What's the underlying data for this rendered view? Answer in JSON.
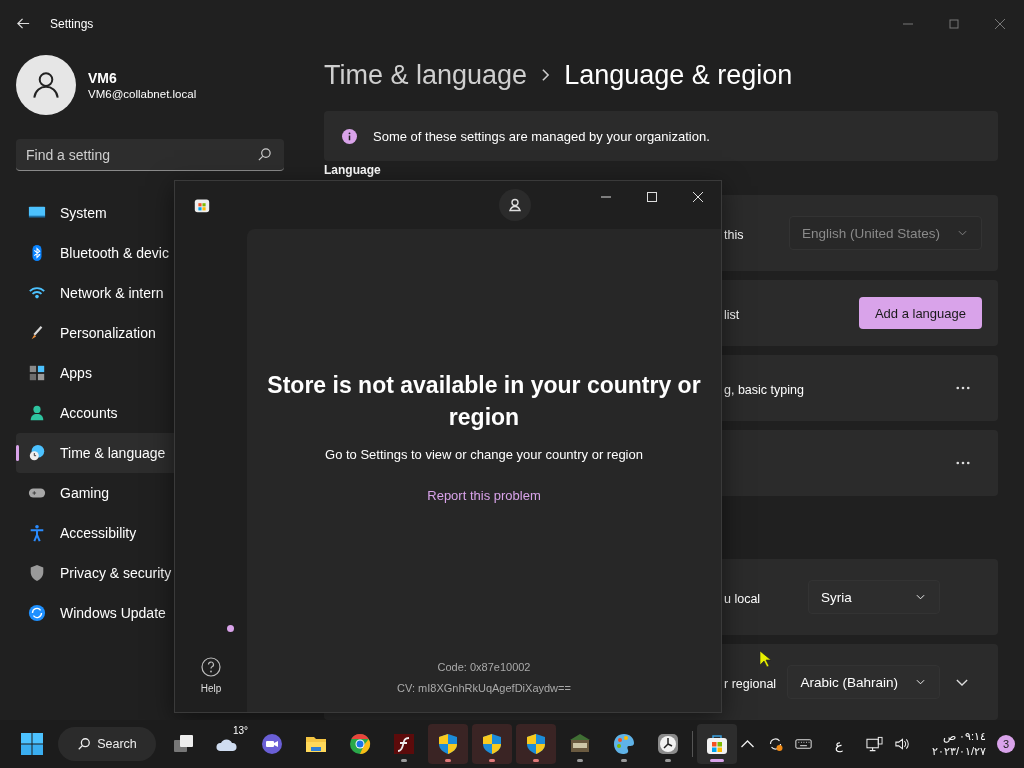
{
  "settings_window": {
    "title": "Settings",
    "profile": {
      "name": "VM6",
      "email": "VM6@collabnet.local"
    },
    "search": {
      "placeholder": "Find a setting"
    },
    "sidebar": {
      "items": [
        {
          "label": "System",
          "kind": "system",
          "selected": false
        },
        {
          "label": "Bluetooth & devic",
          "kind": "bluetooth",
          "selected": false
        },
        {
          "label": "Network & intern",
          "kind": "network",
          "selected": false
        },
        {
          "label": "Personalization",
          "kind": "personalization",
          "selected": false
        },
        {
          "label": "Apps",
          "kind": "apps",
          "selected": false
        },
        {
          "label": "Accounts",
          "kind": "accounts",
          "selected": false
        },
        {
          "label": "Time & language",
          "kind": "time",
          "selected": true
        },
        {
          "label": "Gaming",
          "kind": "gaming",
          "selected": false
        },
        {
          "label": "Accessibility",
          "kind": "accessibility",
          "selected": false
        },
        {
          "label": "Privacy & security",
          "kind": "privacy",
          "selected": false
        },
        {
          "label": "Windows Update",
          "kind": "update",
          "selected": false
        }
      ]
    },
    "breadcrumb": [
      "Time & language",
      "Language & region"
    ],
    "info_bar": {
      "text": "Some of these settings are managed by your organization."
    },
    "section_heading": "Language",
    "language_cards": [
      {
        "label": "this",
        "kind": "dropdown",
        "value": "English (United States)",
        "disabled": true
      },
      {
        "label": "list",
        "kind": "button",
        "value": "Add a language"
      },
      {
        "label": "g, basic typing",
        "kind": "more"
      },
      {
        "kind": "more"
      }
    ],
    "region_cards": [
      {
        "label": "u local",
        "kind": "dropdown",
        "value": "Syria",
        "disabled": false,
        "expandable": false
      },
      {
        "label": "r regional",
        "kind": "dropdown",
        "value": "Arabic (Bahrain)",
        "disabled": false,
        "expandable": true
      }
    ]
  },
  "store_window": {
    "notification_dot": true,
    "help_label": "Help",
    "heading": "Store is not available in your country or region",
    "message": "Go to Settings to view or change your country or region",
    "link": "Report this problem",
    "code": "Code: 0x87e10002",
    "cv": "CV: mI8XGnhRkUqAgefDiXaydw=="
  },
  "taskbar": {
    "search_label": "Search",
    "weather": "13°",
    "apps": [
      {
        "kind": "taskview",
        "running": false,
        "attention": false,
        "selected": false
      },
      {
        "kind": "weather",
        "running": false,
        "attention": false,
        "selected": false
      },
      {
        "kind": "meet",
        "running": false,
        "attention": false,
        "selected": false
      },
      {
        "kind": "explorer",
        "running": false,
        "attention": false,
        "selected": false
      },
      {
        "kind": "chrome",
        "running": false,
        "attention": false,
        "selected": false
      },
      {
        "kind": "flash",
        "running": true,
        "attention": false,
        "selected": false
      },
      {
        "kind": "shield",
        "running": true,
        "attention": true,
        "selected": false
      },
      {
        "kind": "shield",
        "running": true,
        "attention": true,
        "selected": false
      },
      {
        "kind": "shield",
        "running": true,
        "attention": true,
        "selected": false
      },
      {
        "kind": "minecraft",
        "running": true,
        "attention": false,
        "selected": false
      },
      {
        "kind": "paint",
        "running": true,
        "attention": false,
        "selected": false
      },
      {
        "kind": "clock",
        "running": true,
        "attention": false,
        "selected": false
      },
      {
        "kind": "store",
        "running": true,
        "attention": false,
        "selected": true
      }
    ],
    "tray": {
      "language": "ع",
      "time": "٠٩:١٤ ص",
      "date": "٢٠٢٣/٠١/٢٧",
      "notifications": "3"
    }
  }
}
